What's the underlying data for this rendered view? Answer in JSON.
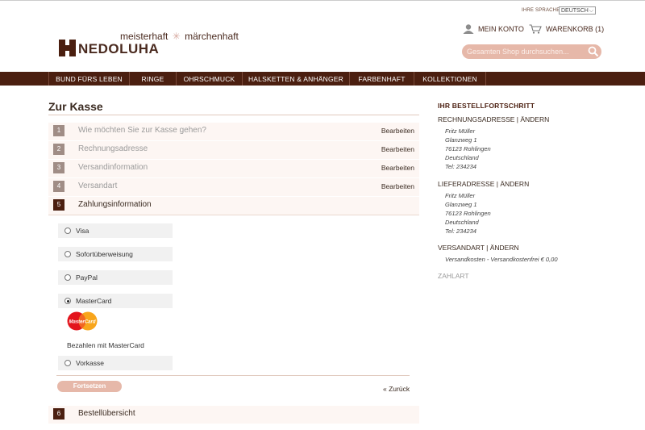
{
  "header": {
    "language_label": "IHRE SPRACHE:",
    "language_value": "DEUTSCH",
    "tagline_left": "meisterhaft",
    "tagline_right": "märchenhaft",
    "logo_text": "NEDOLUHA",
    "account_label": "MEIN KONTO",
    "cart_label": "WARENKORB (1)",
    "search_placeholder": "Gesamten Shop durchsuchen..."
  },
  "nav": {
    "items": [
      "BUND FÜRS LEBEN",
      "RINGE",
      "OHRSCHMUCK",
      "HALSKETTEN & ANHÄNGER",
      "FARBENHAFT",
      "KOLLEKTIONEN"
    ]
  },
  "checkout": {
    "title": "Zur Kasse",
    "edit_label": "Bearbeiten",
    "steps": [
      {
        "num": "1",
        "label": "Wie möchten Sie zur Kasse gehen?"
      },
      {
        "num": "2",
        "label": "Rechnungsadresse"
      },
      {
        "num": "3",
        "label": "Versandinformation"
      },
      {
        "num": "4",
        "label": "Versandart"
      },
      {
        "num": "5",
        "label": "Zahlungsinformation"
      },
      {
        "num": "6",
        "label": "Bestellübersicht"
      }
    ],
    "payment_options": [
      "Visa",
      "Sofortüberweisung",
      "PayPal",
      "MasterCard",
      "Vorkasse"
    ],
    "selected_payment": "MasterCard",
    "mastercard_logo_text": "MasterCard",
    "mastercard_note": "Bezahlen mit MasterCard",
    "continue_label": "Fortsetzen",
    "back_label": "« Zurück"
  },
  "sidebar": {
    "title": "IHR BESTELLFORTSCHRITT",
    "billing_head": "RECHNUNGSADRESSE | ÄNDERN",
    "billing_lines": [
      "Fritz Müller",
      "Glanzweg 1",
      "76123 Rohlingen",
      "Deutschland",
      "Tel: 234234"
    ],
    "shipping_head": "LIEFERADRESSE | ÄNDERN",
    "shipping_lines": [
      "Fritz Müller",
      "Glanzweg 1",
      "76123 Rohlingen",
      "Deutschland",
      "Tel: 234234"
    ],
    "method_head": "VERSANDART | ÄNDERN",
    "method_line": "Versandkosten - Versandkostenfrei € 0,00",
    "payment_head": "ZAHLART"
  },
  "colors": {
    "brand_dark": "#4b1f10",
    "accent_pink": "#e6b8a9",
    "step_bg": "#fdf6f3"
  }
}
